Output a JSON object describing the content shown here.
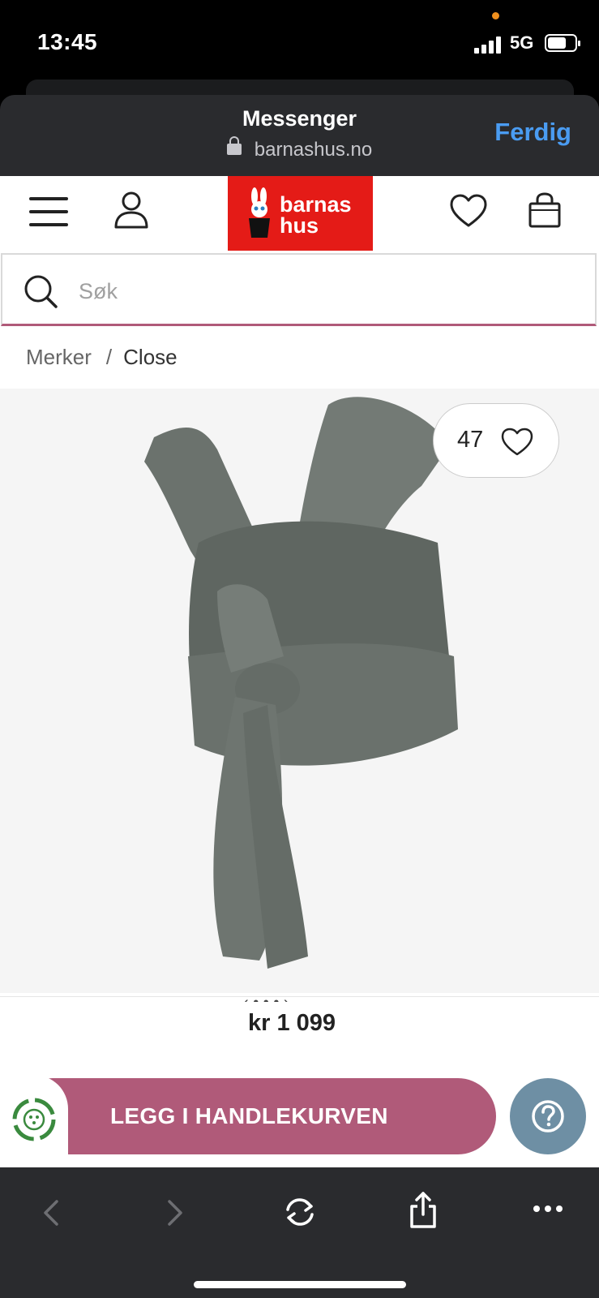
{
  "status_bar": {
    "time": "13:45",
    "network": "5G",
    "icons": [
      "signal-icon",
      "battery-icon"
    ]
  },
  "messenger": {
    "title": "Messenger",
    "url": "barnashus.no",
    "done_label": "Ferdig"
  },
  "nav": {
    "icons": [
      "menu-icon",
      "user-icon",
      "heart-icon",
      "shopping-bag-icon"
    ],
    "logo_line1": "barnas",
    "logo_line2": "hus"
  },
  "search": {
    "placeholder": "Søk"
  },
  "breadcrumb": {
    "parent": "Merker",
    "separator": "/",
    "current": "Close"
  },
  "product": {
    "favorite_count": "47",
    "price": "kr 1 099",
    "add_to_cart": "LEGG I HANDLEKURVEN"
  },
  "colors": {
    "brand_red": "#e41b17",
    "accent_pink": "#b05a79",
    "help_blue": "#6e8fa4",
    "ios_link": "#4a9cf2"
  }
}
